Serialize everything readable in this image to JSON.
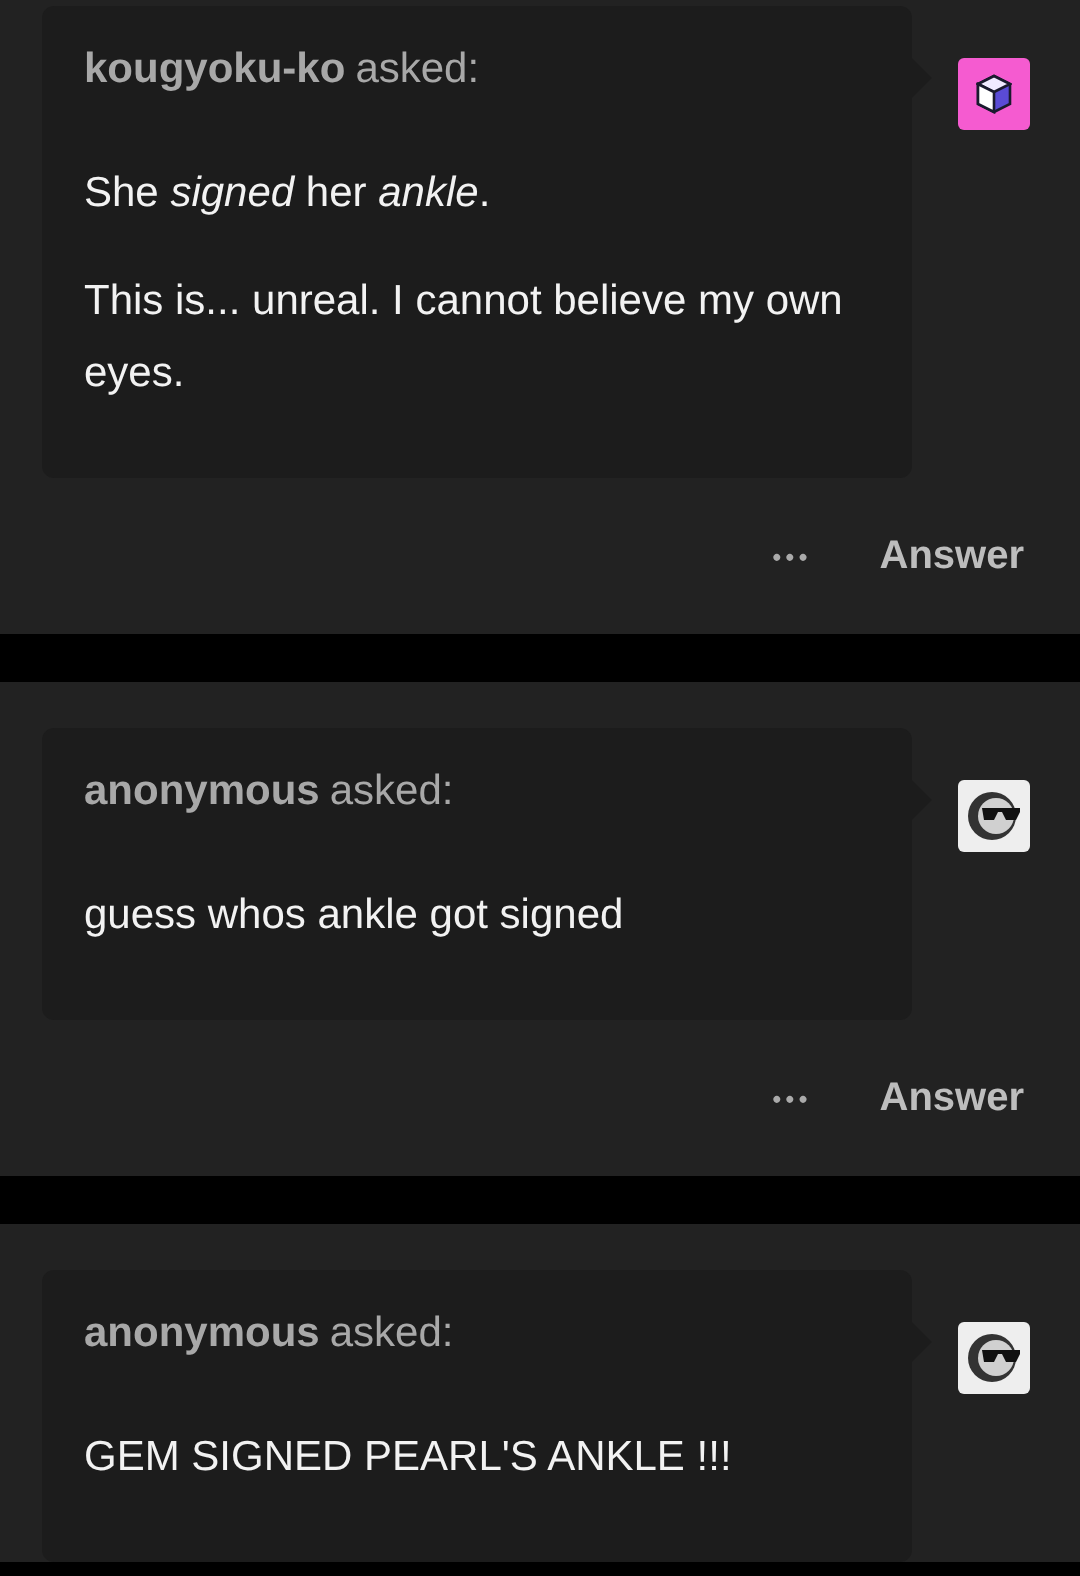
{
  "posts": [
    {
      "asker": "kougyoku-ko",
      "asked_label": "asked:",
      "avatar": {
        "kind": "cube",
        "color": "#f55bd0"
      },
      "paragraphs": [
        "She *signed* her *ankle*.",
        "This is... unreal. I cannot believe my own eyes."
      ],
      "actions": {
        "more": "•••",
        "answer": "Answer"
      }
    },
    {
      "asker": "anonymous",
      "asked_label": "asked:",
      "avatar": {
        "kind": "sunglasses",
        "color": "#eeeeee"
      },
      "paragraphs": [
        "guess whos ankle got signed"
      ],
      "actions": {
        "more": "•••",
        "answer": "Answer"
      }
    },
    {
      "asker": "anonymous",
      "asked_label": "asked:",
      "avatar": {
        "kind": "sunglasses",
        "color": "#eeeeee"
      },
      "paragraphs": [
        "GEM SIGNED PEARL'S ANKLE !!!"
      ]
    }
  ]
}
